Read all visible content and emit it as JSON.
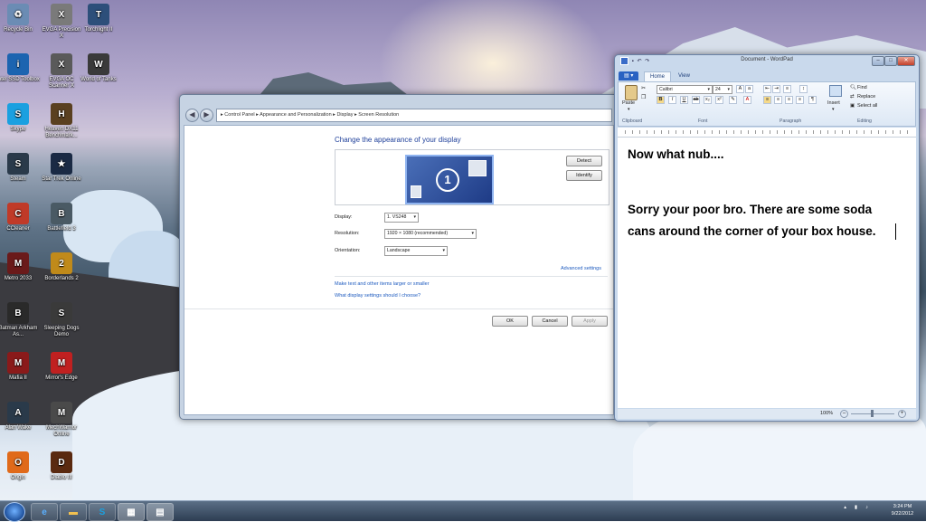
{
  "desktop_icons": [
    {
      "label": "Recycle Bin",
      "color": "#6b8cb4",
      "glyph": "♻"
    },
    {
      "label": "EVGA Precision X",
      "color": "#7a7a7a",
      "glyph": "X"
    },
    {
      "label": "Torchlight II",
      "color": "#2d4f7a",
      "glyph": "T"
    },
    {
      "label": "Intel SSD Toolbox",
      "color": "#1c64b0",
      "glyph": "i"
    },
    {
      "label": "EVGA OC Scanner X",
      "color": "#5a5a5a",
      "glyph": "X"
    },
    {
      "label": "World of Tanks",
      "color": "#3a3a3a",
      "glyph": "W"
    },
    {
      "label": "Skype",
      "color": "#1aa0e0",
      "glyph": "S"
    },
    {
      "label": "Heaven DX11 Benchmark...",
      "color": "#5a4020",
      "glyph": "H"
    },
    {
      "label": "Steam",
      "color": "#2a3a4a",
      "glyph": "S"
    },
    {
      "label": "Star Trek Online",
      "color": "#1a2a44",
      "glyph": "★"
    },
    {
      "label": "CCleaner",
      "color": "#c03a28",
      "glyph": "C"
    },
    {
      "label": "Battlefield 3",
      "color": "#4a5a64",
      "glyph": "B"
    },
    {
      "label": "Metro 2033",
      "color": "#6a1a1a",
      "glyph": "M"
    },
    {
      "label": "Borderlands 2",
      "color": "#c08a1a",
      "glyph": "2"
    },
    {
      "label": "Batman Arkham As...",
      "color": "#2a2a2a",
      "glyph": "B"
    },
    {
      "label": "Sleeping Dogs Demo",
      "color": "#3a3a3a",
      "glyph": "S"
    },
    {
      "label": "Mafia II",
      "color": "#8a1a1a",
      "glyph": "M"
    },
    {
      "label": "Mirror's Edge",
      "color": "#c02020",
      "glyph": "M"
    },
    {
      "label": "Alan Wake",
      "color": "#2a3a4a",
      "glyph": "A"
    },
    {
      "label": "MechWarrior Online",
      "color": "#4a4a4a",
      "glyph": "M"
    },
    {
      "label": "Origin",
      "color": "#e06a1a",
      "glyph": "O"
    },
    {
      "label": "Diablo III",
      "color": "#5a2a10",
      "glyph": "D"
    }
  ],
  "control_panel": {
    "breadcrumb": "▸ Control Panel ▸ Appearance and Personalization ▸ Display ▸ Screen Resolution",
    "heading": "Change the appearance of your display",
    "monitor_number": "1",
    "detect_label": "Detect",
    "identify_label": "Identify",
    "display_label": "Display:",
    "display_value": "1. VS248",
    "resolution_label": "Resolution:",
    "resolution_value": "1920 × 1080 (recommended)",
    "orientation_label": "Orientation:",
    "orientation_value": "Landscape",
    "advanced_link": "Advanced settings",
    "text_size_link": "Make text and other items larger or smaller",
    "help_link": "What display settings should I choose?",
    "ok_label": "OK",
    "cancel_label": "Cancel",
    "apply_label": "Apply"
  },
  "wordpad": {
    "title": "Document - WordPad",
    "tab_home": "Home",
    "tab_view": "View",
    "paste_label": "Paste",
    "clipboard_label": "Clipboard",
    "font_name": "Calibri",
    "font_size": "24",
    "font_group": "Font",
    "paragraph_group": "Paragraph",
    "insert_label": "Insert",
    "find_label": "Find",
    "replace_label": "Replace",
    "select_all_label": "Select all",
    "editing_group": "Editing",
    "line1": "Now what nub....",
    "line2": "Sorry your poor bro. There are some soda",
    "line3": "cans around the corner of your box house.",
    "zoom": "100%"
  },
  "taskbar": {
    "time": "3:24 PM",
    "date": "9/22/2012"
  }
}
